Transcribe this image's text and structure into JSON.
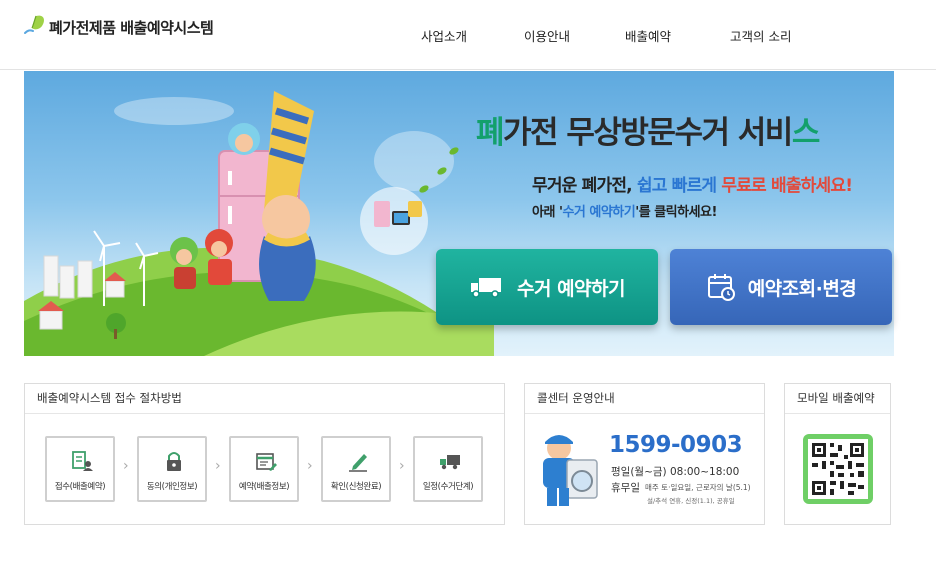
{
  "brand": {
    "title": "폐가전제품 배출예약시스템",
    "leaf_color": "#8cc63f"
  },
  "nav": {
    "items": [
      {
        "label": "사업소개"
      },
      {
        "label": "이용안내"
      },
      {
        "label": "배출예약"
      },
      {
        "label": "고객의 소리"
      }
    ]
  },
  "hero": {
    "title_accent_first": "폐",
    "title_middle": "가전 무상방문수거 서비",
    "title_accent_last": "스",
    "sub1_a": "무거운 ",
    "sub1_b": "폐가전, ",
    "sub1_c": "쉽고 빠르게 ",
    "sub1_d": "무료로 배출하세요!",
    "sub2_a": "아래 '",
    "sub2_b": "수거 예약하기",
    "sub2_c": "'를 클릭하세요!",
    "btn_reserve_label": "수거 예약하기",
    "btn_check_label": "예약조회·변경",
    "accent_color": "#13a06c",
    "reserve_color": "#0e9384",
    "check_color": "#3666b8"
  },
  "process": {
    "title": "배출예약시스템 접수 절차방법",
    "steps": [
      {
        "label": "접수(배출예약)",
        "icon": "document-user-icon"
      },
      {
        "label": "동의(개인정보)",
        "icon": "lock-icon"
      },
      {
        "label": "예약(배출정보)",
        "icon": "calendar-edit-icon"
      },
      {
        "label": "확인(신청완료)",
        "icon": "pencil-icon"
      },
      {
        "label": "일정(수거단계)",
        "icon": "truck-icon"
      }
    ]
  },
  "callcenter": {
    "title": "콜센터 운영안내",
    "phone": "1599-0903",
    "weekday": "평일(월~금)  08:00~18:00",
    "holiday_label": "휴무일",
    "holiday_detail": "매주 토·일요일, 근로자의 날(5.1)",
    "holiday_detail2": "설/추석 연휴, 신정(1.1), 공휴일"
  },
  "mobile": {
    "title": "모바일 배출예약",
    "qr_icon": "qr-code-icon"
  }
}
